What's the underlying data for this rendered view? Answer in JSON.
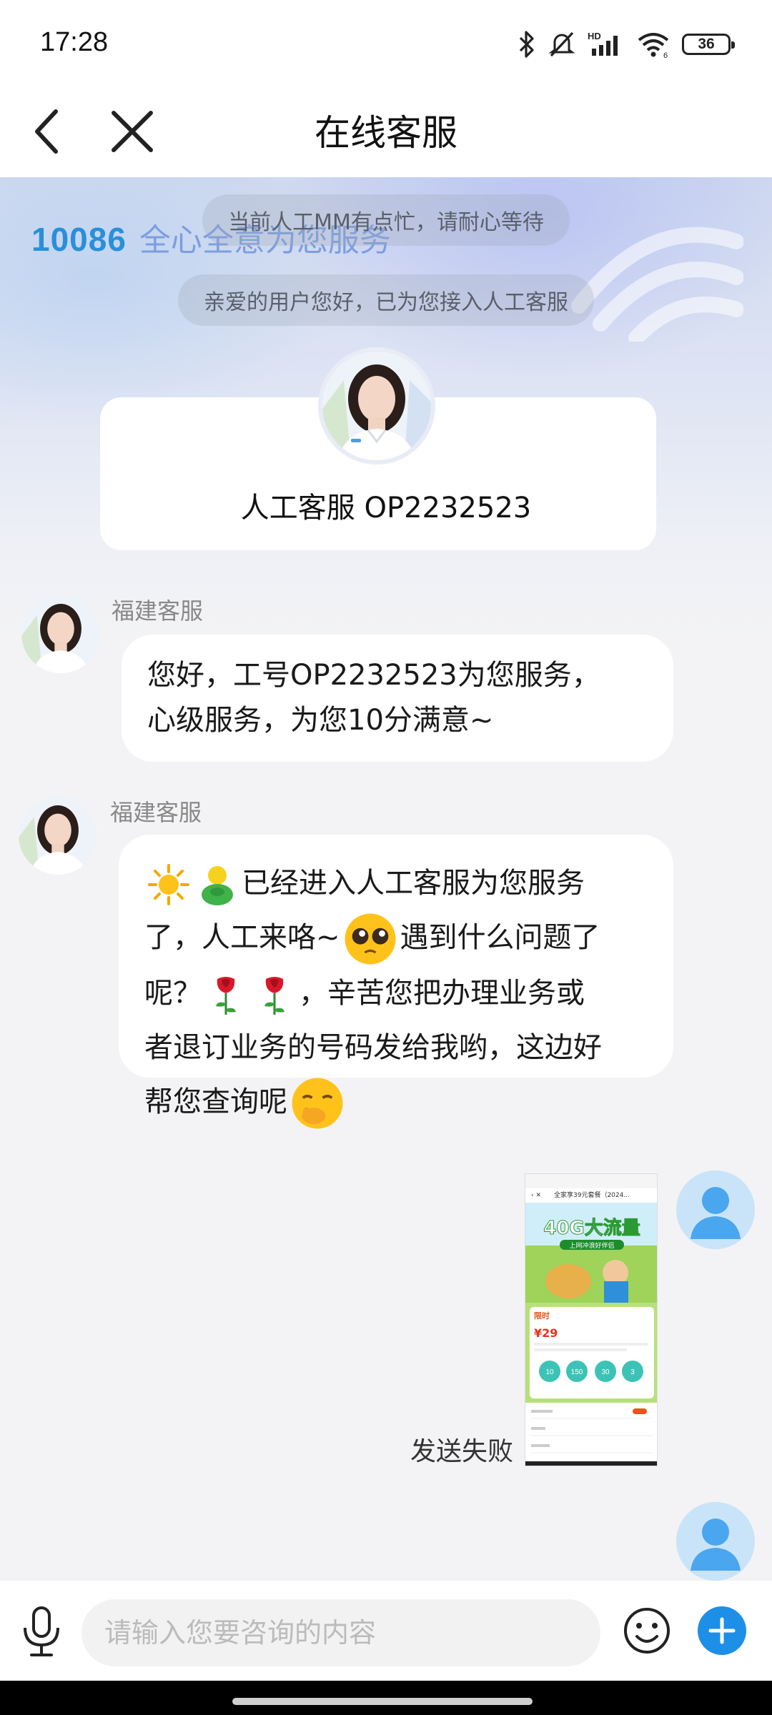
{
  "status_bar": {
    "time": "17:28",
    "battery": "36"
  },
  "header": {
    "title": "在线客服"
  },
  "banner": {
    "brand_number": "10086",
    "slogan": "全心全意为您服务"
  },
  "system_messages": [
    "当前人工MM有点忙，请耐心等待",
    "亲爱的用户您好，已为您接入人工客服"
  ],
  "agent_card": {
    "name": "人工客服 OP2232523"
  },
  "messages": [
    {
      "sender": "福建客服",
      "lines": [
        "您好，工号OP2232523为您服务，",
        "心级服务，为您10分满意~"
      ]
    },
    {
      "sender": "福建客服",
      "line1": "已经进入人工客服为您服务",
      "line2a": "了，人工来咯~",
      "line2b": "遇到什么问题了",
      "line3a": "呢？",
      "line3b": "，辛苦您把办理业务或",
      "line4": "者退订业务的号码发给我哟，这边好",
      "line5": "帮您查询呢"
    }
  ],
  "user_message": {
    "status": "发送失败",
    "thumbnail": {
      "title": "全家享39元套餐（2024...",
      "headline": "40G大流量",
      "subline": "上网冲浪好伴侣",
      "badge": "限时",
      "price": "¥29",
      "stats": [
        "10",
        "150",
        "30",
        "3"
      ]
    }
  },
  "input": {
    "placeholder": "请输入您要咨询的内容"
  },
  "colors": {
    "accent": "#1e8fe6",
    "bubble": "#ffffff",
    "background": "#f3f3f5"
  }
}
